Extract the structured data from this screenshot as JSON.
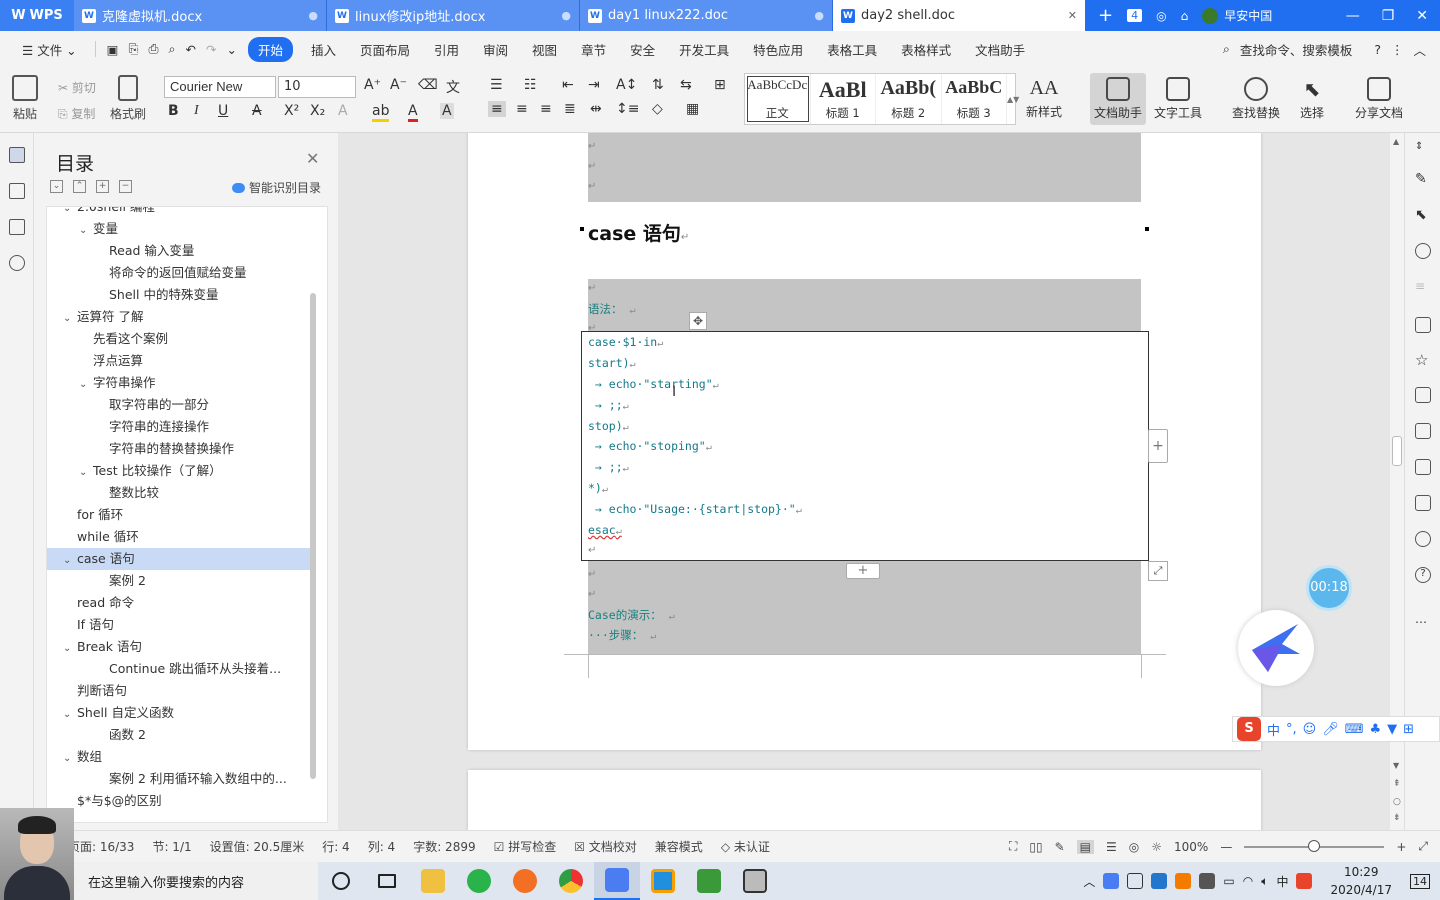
{
  "app": {
    "logo_text": "WPS"
  },
  "tabs": [
    {
      "label": "克隆虚拟机.docx",
      "icon": "W"
    },
    {
      "label": "linux修改ip地址.docx",
      "icon": "W"
    },
    {
      "label": "day1 linux222.doc",
      "icon": "W"
    },
    {
      "label": "day2 shell.doc",
      "icon": "W",
      "active": true
    }
  ],
  "titlebar": {
    "add": "+",
    "window_count": "4",
    "user_name": "早安中国"
  },
  "menu": {
    "file": "文件",
    "items": [
      "开始",
      "插入",
      "页面布局",
      "引用",
      "审阅",
      "视图",
      "章节",
      "安全",
      "开发工具",
      "特色应用",
      "表格工具",
      "表格样式",
      "文档助手"
    ],
    "search_placeholder": "查找命令、搜索模板",
    "help": "?"
  },
  "ribbon": {
    "paste": "粘贴",
    "cut": "剪切",
    "copy": "复制",
    "format_painter": "格式刷",
    "font_name": "Courier New",
    "font_size": "10",
    "styles": [
      {
        "preview": "AaBbCcDc",
        "name": "正文"
      },
      {
        "preview": "AaBl",
        "name": "标题 1"
      },
      {
        "preview": "AaBb(",
        "name": "标题 2"
      },
      {
        "preview": "AaBbC",
        "name": "标题 3"
      }
    ],
    "new_style": "新样式",
    "doc_helper": "文档助手",
    "text_tools": "文字工具",
    "find_replace": "查找替换",
    "select": "选择",
    "share": "分享文档"
  },
  "toc": {
    "title": "目录",
    "smart": "智能识别目录",
    "items": [
      {
        "text": "2.0shell 编程",
        "level": 1,
        "arrow": "v"
      },
      {
        "text": "变量",
        "level": 2,
        "arrow": "v"
      },
      {
        "text": "Read  输入变量",
        "level": 3,
        "arrow": ""
      },
      {
        "text": "将命令的返回值赋给变量",
        "level": 3,
        "arrow": ""
      },
      {
        "text": "Shell 中的特殊变量",
        "level": 3,
        "arrow": ""
      },
      {
        "text": "运算符  了解",
        "level": 1,
        "arrow": "v"
      },
      {
        "text": "先看这个案例",
        "level": 2,
        "arrow": ""
      },
      {
        "text": "浮点运算",
        "level": 2,
        "arrow": ""
      },
      {
        "text": "字符串操作",
        "level": 2,
        "arrow": "v"
      },
      {
        "text": "取字符串的一部分",
        "level": 3,
        "arrow": ""
      },
      {
        "text": "字符串的连接操作",
        "level": 3,
        "arrow": ""
      },
      {
        "text": "字符串的替换替换操作",
        "level": 3,
        "arrow": ""
      },
      {
        "text": "Test 比较操作（了解）",
        "level": 2,
        "arrow": "v"
      },
      {
        "text": "整数比较",
        "level": 3,
        "arrow": ""
      },
      {
        "text": "for 循环",
        "level": 1,
        "arrow": ""
      },
      {
        "text": "while 循环",
        "level": 1,
        "arrow": ""
      },
      {
        "text": "case 语句",
        "level": 1,
        "arrow": "v",
        "selected": true
      },
      {
        "text": "案例 2",
        "level": 3,
        "arrow": ""
      },
      {
        "text": "read 命令",
        "level": 1,
        "arrow": ""
      },
      {
        "text": "If 语句",
        "level": 1,
        "arrow": ""
      },
      {
        "text": "Break 语句",
        "level": 1,
        "arrow": "v"
      },
      {
        "text": "Continue    跳出循环从头接着...",
        "level": 3,
        "arrow": ""
      },
      {
        "text": "判断语句",
        "level": 1,
        "arrow": ""
      },
      {
        "text": "Shell 自定义函数",
        "level": 1,
        "arrow": "v"
      },
      {
        "text": "函数 2",
        "level": 3,
        "arrow": ""
      },
      {
        "text": "数组",
        "level": 1,
        "arrow": "v"
      },
      {
        "text": "案例 2 利用循环输入数组中的...",
        "level": 3,
        "arrow": ""
      },
      {
        "text": "$*与$@的区别",
        "level": 1,
        "arrow": ""
      }
    ]
  },
  "document": {
    "heading": "case 语句",
    "syntax_label": "语法：",
    "code_lines": [
      "case·$1·in",
      "start)",
      " → echo·\"starting\"",
      " → ;;",
      "stop)",
      " → echo·\"stoping\"",
      " → ;;",
      "*)",
      " → echo·\"Usage:·{start|stop}·\"",
      "esac"
    ],
    "demo_label": "Case的演示：",
    "steps_label": "···步骤："
  },
  "timer": "00:18",
  "ime": {
    "lang": "中"
  },
  "status": {
    "page": "页面: 16/33",
    "section": "节: 1/1",
    "setting": "设置值: 20.5厘米",
    "row": "行: 4",
    "col": "列: 4",
    "words": "字数: 2899",
    "spell": "拼写检查",
    "proof": "文档校对",
    "compat": "兼容模式",
    "cert": "未认证",
    "zoom": "100%"
  },
  "taskbar": {
    "search_placeholder": "在这里输入你要搜索的内容",
    "time": "10:29",
    "date": "2020/4/17",
    "notif_count": "14",
    "ime": "中"
  }
}
